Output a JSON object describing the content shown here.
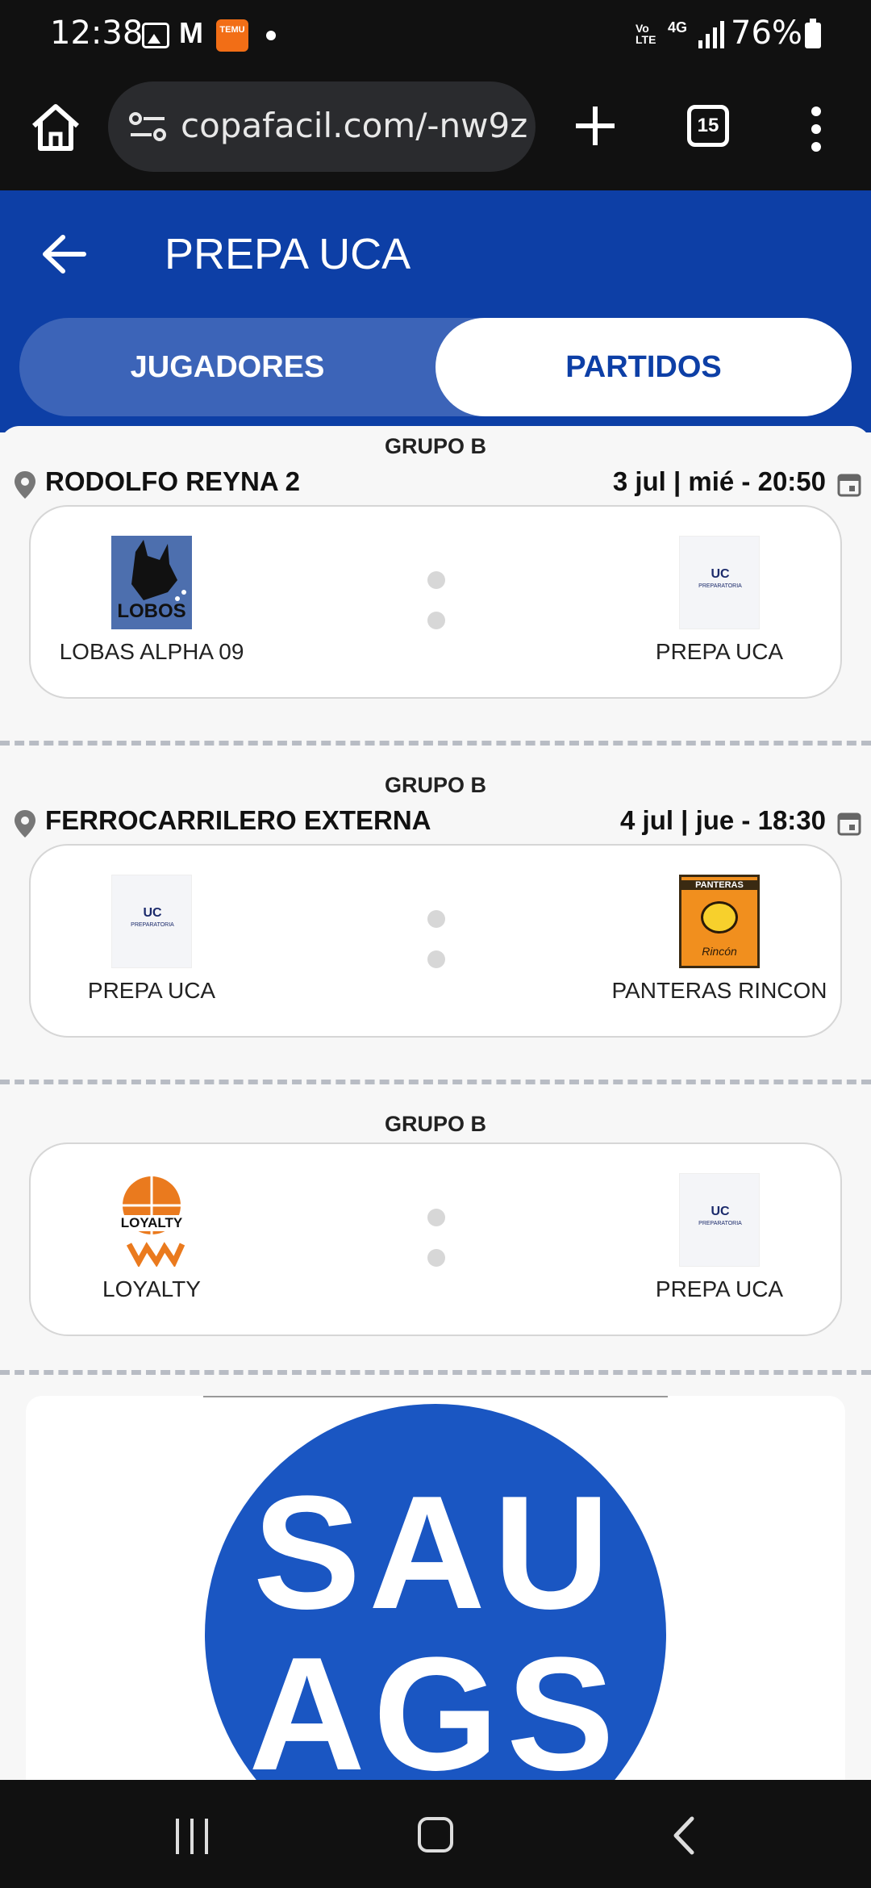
{
  "status_bar": {
    "time": "12:38",
    "battery": "76%",
    "network": "4G",
    "volte": "Vo LTE",
    "temu_label": "TEMU",
    "icons": [
      "photo-icon",
      "gmail-icon",
      "temu-icon",
      "notification-dot-icon",
      "signal-icon",
      "battery-icon"
    ]
  },
  "browser": {
    "url": "copafacil.com/-nw9z",
    "tab_count": "15"
  },
  "header": {
    "title": "PREPA UCA",
    "tabs": [
      {
        "label": "JUGADORES",
        "active": false
      },
      {
        "label": "PARTIDOS",
        "active": true
      }
    ]
  },
  "matches": [
    {
      "group": "GRUPO B",
      "venue": "RODOLFO REYNA 2",
      "date": "3 jul | mié - 20:50",
      "home": {
        "name": "LOBAS ALPHA 09",
        "logo": "lobos-logo",
        "logo_text": "LOBOS"
      },
      "away": {
        "name": "PREPA UCA",
        "logo": "uca-logo",
        "logo_text": "UC",
        "logo_subtext": "PREPARATORIA"
      }
    },
    {
      "group": "GRUPO B",
      "venue": "FERROCARRILERO EXTERNA",
      "date": "4 jul | jue - 18:30",
      "home": {
        "name": "PREPA UCA",
        "logo": "uca-logo",
        "logo_text": "UC",
        "logo_subtext": "PREPARATORIA"
      },
      "away": {
        "name": "PANTERAS RINCON",
        "logo": "panteras-logo",
        "logo_text": "PANTERAS",
        "logo_subtext": "Rincón"
      }
    },
    {
      "group": "GRUPO B",
      "venue": "",
      "date": "",
      "home": {
        "name": "LOYALTY",
        "logo": "loyalty-logo",
        "logo_text": "LOYALTY"
      },
      "away": {
        "name": "PREPA UCA",
        "logo": "uca-logo",
        "logo_text": "UC",
        "logo_subtext": "PREPARATORIA"
      }
    }
  ],
  "ad": {
    "line1": "SAU",
    "line2": "AGS"
  },
  "colors": {
    "primary": "#0d3fa6",
    "tab_inactive": "#3c64b8",
    "background": "#f7f7f7",
    "system_bar": "#111111"
  }
}
